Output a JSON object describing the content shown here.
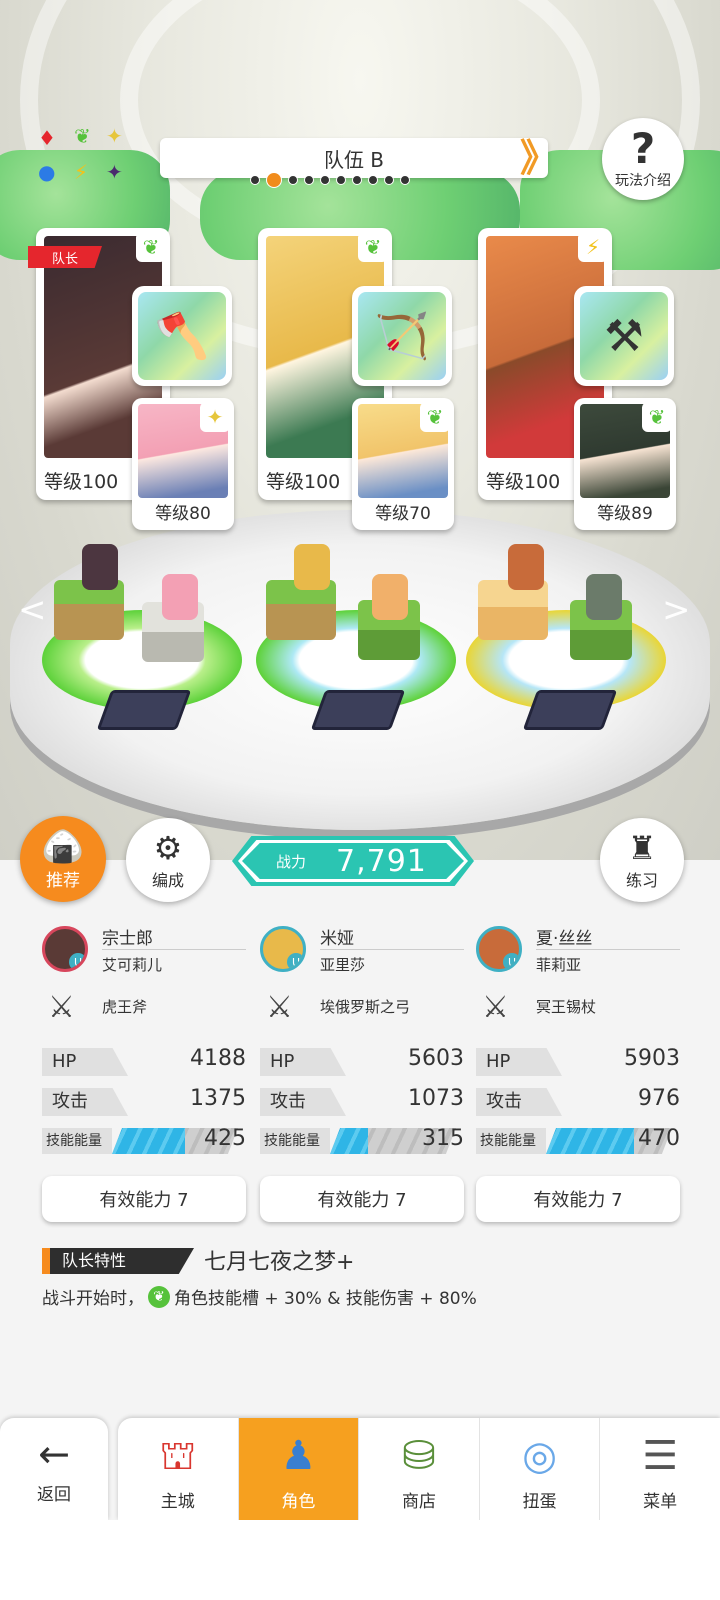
{
  "team": {
    "name": "队伍 B",
    "page_count": 10,
    "current_page": 2
  },
  "help": {
    "label": "玩法介绍",
    "icon": "question-icon"
  },
  "captain_tag": "队长",
  "heroes": [
    {
      "level": "等级100",
      "element": "leaf-icon",
      "sub_level": "等级80",
      "sub_element": "star-icon",
      "weapon_icon": "axe-icon",
      "portrait_color": "#5a3a36"
    },
    {
      "level": "等级100",
      "element": "leaf-icon",
      "sub_level": "等级70",
      "sub_element": "leaf-icon",
      "weapon_icon": "bow-icon",
      "portrait_color": "#e8b94a"
    },
    {
      "level": "等级100",
      "element": "bolt-icon",
      "sub_level": "等级89",
      "sub_element": "leaf-icon",
      "weapon_icon": "scythe-icon",
      "portrait_color": "#c86b3a"
    }
  ],
  "actions": {
    "recommend": "推荐",
    "formation": "编成",
    "practice": "练习"
  },
  "power": {
    "label": "战力",
    "value": "7,791"
  },
  "stats": [
    {
      "hero": "宗士郎",
      "sub": "艾可莉儿",
      "weapon": "虎王斧",
      "hp_label": "HP",
      "hp": "4188",
      "atk_label": "攻击",
      "atk": "1375",
      "energy_label": "技能能量",
      "energy": "425",
      "energy_fill": 0.58,
      "ability": "有效能力 7"
    },
    {
      "hero": "米娅",
      "sub": "亚里莎",
      "weapon": "埃俄罗斯之弓",
      "hp_label": "HP",
      "hp": "5603",
      "atk_label": "攻击",
      "atk": "1073",
      "energy_label": "技能能量",
      "energy": "315",
      "energy_fill": 0.3,
      "ability": "有效能力 7"
    },
    {
      "hero": "夏·丝丝",
      "sub": "菲莉亚",
      "weapon": "冥王锡杖",
      "hp_label": "HP",
      "hp": "5903",
      "atk_label": "攻击",
      "atk": "976",
      "energy_label": "技能能量",
      "energy": "470",
      "energy_fill": 0.7,
      "ability": "有效能力 7"
    }
  ],
  "leader_trait": {
    "tag": "队长特性",
    "name": "七月七夜之梦+",
    "desc_prefix": "战斗开始时，",
    "desc_body": "角色技能槽 + 30% & 技能伤害 + 80%"
  },
  "nav": {
    "back": "返回",
    "items": [
      {
        "label": "主城",
        "icon": "castle-icon"
      },
      {
        "label": "角色",
        "icon": "character-icon",
        "active": true
      },
      {
        "label": "商店",
        "icon": "shop-icon"
      },
      {
        "label": "扭蛋",
        "icon": "gacha-icon"
      },
      {
        "label": "菜单",
        "icon": "menu-icon"
      }
    ]
  },
  "colors": {
    "accent": "#f68b1e",
    "power": "#2bc5b2",
    "energy": "#2fb5e6",
    "captain": "#e5262d"
  }
}
